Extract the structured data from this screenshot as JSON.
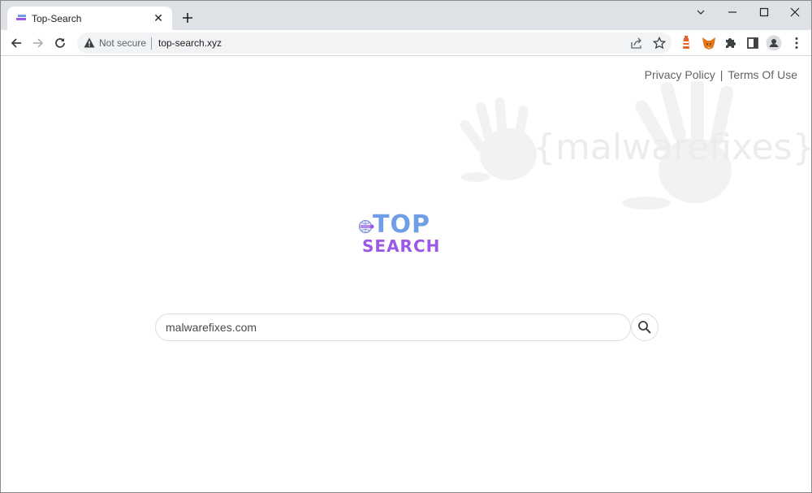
{
  "browser": {
    "tab": {
      "title": "Top-Search",
      "favicon": "top-search-favicon",
      "close_icon": "close-icon"
    },
    "new_tab_icon": "plus-icon",
    "window_controls": [
      "tab-search-chevron",
      "minimize",
      "maximize",
      "close"
    ],
    "toolbar": {
      "back_icon": "arrow-left-icon",
      "forward_icon": "arrow-right-icon",
      "reload_icon": "reload-icon",
      "security_label": "Not secure",
      "url": "top-search.xyz",
      "share_icon": "share-icon",
      "bookmark_icon": "star-icon",
      "extensions": [
        "lighthouse-extension-icon",
        "metamask-fox-icon",
        "puzzle-extensions-icon",
        "side-panel-icon",
        "profile-avatar-icon",
        "kebab-menu-icon"
      ]
    }
  },
  "page": {
    "links": {
      "privacy": "Privacy Policy",
      "separator": "|",
      "terms": "Terms Of Use"
    },
    "watermark": "{malwarefixes}",
    "logo": {
      "top": "TOP",
      "bottom": "SEARCH"
    },
    "search": {
      "value": "malwarefixes.com",
      "placeholder": ""
    },
    "colors": {
      "logo_blue": "#6f9de6",
      "logo_purple": "#9c59e8",
      "link_gray": "#5f6368"
    }
  }
}
